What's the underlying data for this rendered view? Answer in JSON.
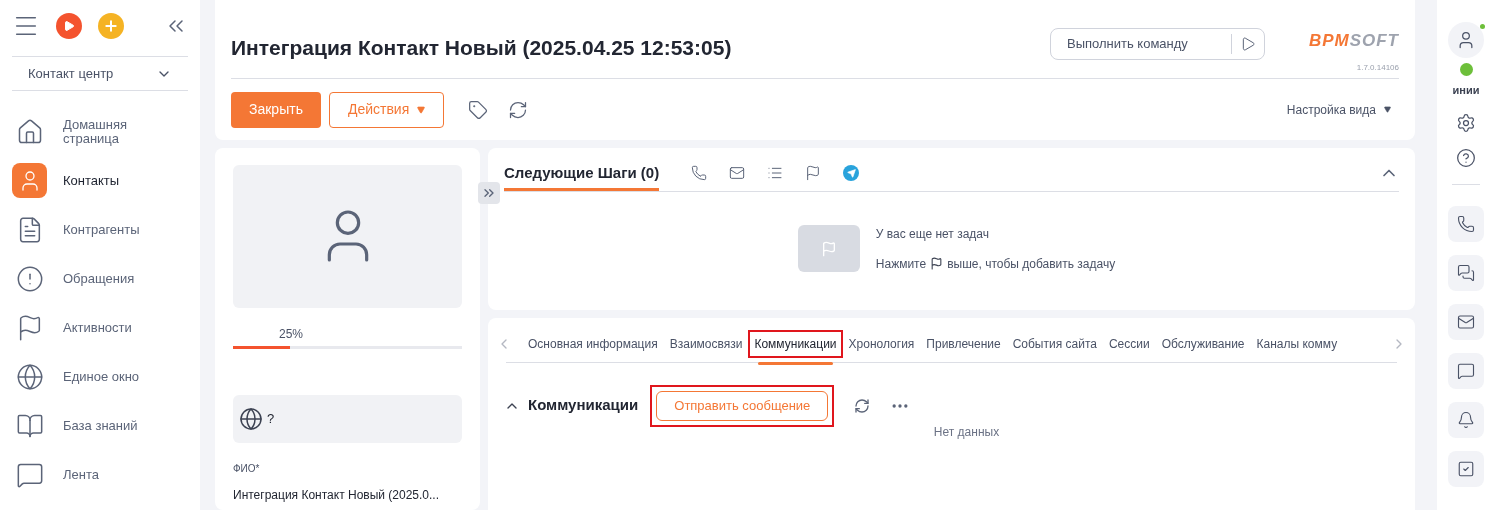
{
  "sidebar": {
    "workplace": "Контакт центр",
    "items": [
      {
        "label": "Домашняя страница",
        "selected": false
      },
      {
        "label": "Контакты",
        "selected": true
      },
      {
        "label": "Контрагенты",
        "selected": false
      },
      {
        "label": "Обращения",
        "selected": false
      },
      {
        "label": "Активности",
        "selected": false
      },
      {
        "label": "Единое окно",
        "selected": false
      },
      {
        "label": "База знаний",
        "selected": false
      },
      {
        "label": "Лента",
        "selected": false
      }
    ]
  },
  "header": {
    "title": "Интеграция Контакт Новый (2025.04.25 12:53:05)",
    "command_placeholder": "Выполнить команду",
    "logo": [
      "BPM",
      "SOFT"
    ],
    "version": "1.7.0.14106"
  },
  "toolbar": {
    "close": "Закрыть",
    "actions": "Действия",
    "view_settings": "Настройка вида"
  },
  "profile": {
    "progress": {
      "level": 0.25,
      "reading": "25%"
    },
    "language": "?",
    "field_label": "ФИО*",
    "field_value": "Интеграция Контакт Новый (2025.0..."
  },
  "next_steps": {
    "title": "Следующие Шаги (0)",
    "empty_title": "У вас еще нет задач",
    "hint_before": "Нажмите",
    "hint_after": "выше, чтобы добавить задачу"
  },
  "tabs": [
    {
      "label": "Основная информация",
      "selected": false,
      "highlighted": false
    },
    {
      "label": "Взаимосвязи",
      "selected": false,
      "highlighted": false
    },
    {
      "label": "Коммуникации",
      "selected": true,
      "highlighted": true
    },
    {
      "label": "Хронология",
      "selected": false,
      "highlighted": false
    },
    {
      "label": "Привлечение",
      "selected": false,
      "highlighted": false
    },
    {
      "label": "События сайта",
      "selected": false,
      "highlighted": false
    },
    {
      "label": "Сессии",
      "selected": false,
      "highlighted": false
    },
    {
      "label": "Обслуживание",
      "selected": false,
      "highlighted": false
    },
    {
      "label": "Каналы комму",
      "selected": false,
      "highlighted": false
    }
  ],
  "communications": {
    "title": "Коммуникации",
    "send_button": {
      "label": "Отправить сообщение",
      "highlighted": true
    },
    "empty": "Нет данных"
  },
  "right_rail": {
    "user_label": "инии",
    "online": true
  }
}
